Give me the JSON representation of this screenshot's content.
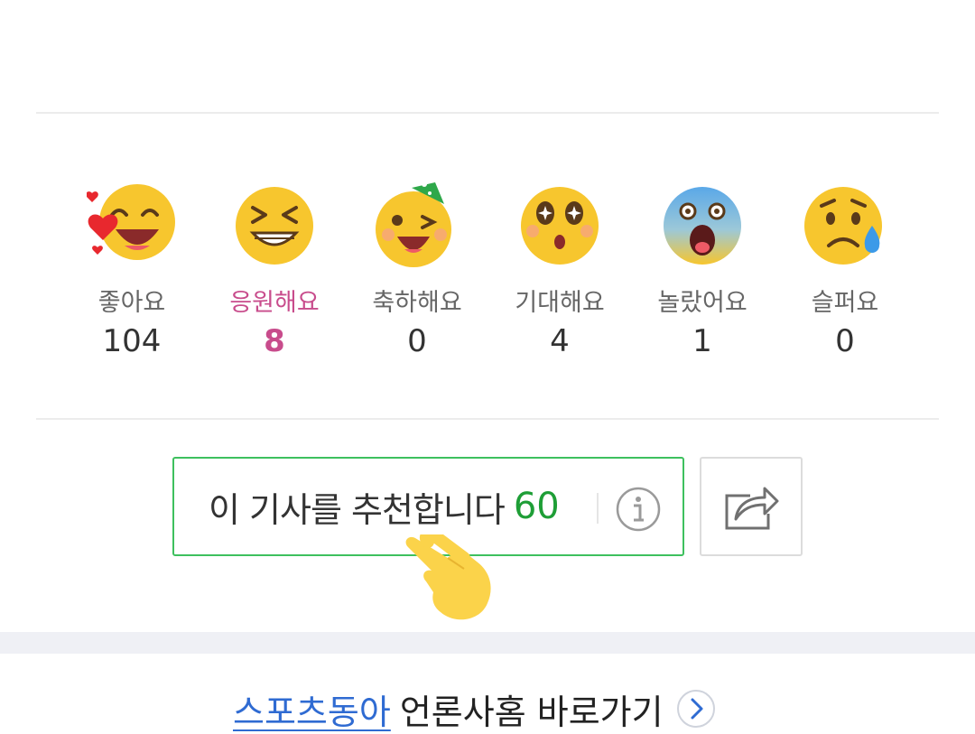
{
  "reactions": [
    {
      "icon": "heart-eyes-laughing-emoji-icon",
      "label": "좋아요",
      "count": "104"
    },
    {
      "icon": "grinning-squint-emoji-icon",
      "label": "응원해요",
      "count": "8"
    },
    {
      "icon": "party-hat-wink-emoji-icon",
      "label": "축하해요",
      "count": "0"
    },
    {
      "icon": "sparkle-eyes-emoji-icon",
      "label": "기대해요",
      "count": "4"
    },
    {
      "icon": "screaming-shocked-emoji-icon",
      "label": "놀랐어요",
      "count": "1"
    },
    {
      "icon": "crying-sad-emoji-icon",
      "label": "슬퍼요",
      "count": "0"
    }
  ],
  "selected_reaction": "응원해요",
  "recommend": {
    "label": "이 기사를 추천합니다",
    "count": "60",
    "info_icon": "info-icon"
  },
  "share": {
    "icon": "share-icon"
  },
  "pointer": {
    "icon": "pointing-hand-icon"
  },
  "press": {
    "name": "스포츠동아",
    "rest": "언론사홈 바로가기",
    "icon": "chevron-right-circle-icon"
  },
  "colors": {
    "accent_green": "#1e9e36",
    "border_green": "#3ec05e",
    "selected_pink": "#c84c8c",
    "link_blue": "#2f6bd2"
  }
}
